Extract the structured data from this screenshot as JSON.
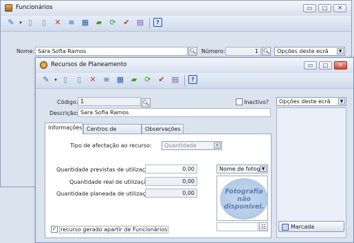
{
  "back_window": {
    "title": "Funcionários",
    "name_label": "Nome:",
    "name_value": "Sara Sofia Ramos",
    "number_label": "Número:",
    "number_value": "1",
    "options_value": "Opções deste ecrã"
  },
  "front_window": {
    "title": "Recursos de Planeamento",
    "codigo_label": "Código:",
    "codigo_value": "1",
    "inactivo_label": "Inactivo?",
    "descricao_label": "Descrição:",
    "descricao_value": "Sara Sofia Ramos",
    "options_value": "Opções deste ecrã",
    "tabs": [
      "Informações",
      "Centros de Trabalho",
      "Observações"
    ],
    "tipo_label": "Tipo de afectação ao recurso:",
    "tipo_value": "Quantidade",
    "qt_prevista_label": "Quantidade previstas de utilização:",
    "qt_prevista_value": "0,00",
    "qt_real_label": "Quantidade real de utilização:",
    "qt_real_value": "0,00",
    "qt_planeada_label": "Quantidade planeada de utilização:",
    "qt_planeada_value": "0,00",
    "photo_select_value": "Nome de fotogr",
    "photo_placeholder": "Fotografia não disponível.",
    "recurso_gerado_label": "recurso gerado apartir de Funcionários",
    "marcada_label": "Marcada"
  },
  "window_buttons": {
    "minimize": "▭",
    "restore": "□",
    "close": "✕"
  },
  "icons": [
    "tools-icon",
    "new-doc-icon",
    "copy-doc-icon",
    "delete-icon",
    "edit-icon",
    "grid-icon",
    "open-folder-icon",
    "refresh-icon",
    "check-icon",
    "print-icon",
    "help-icon"
  ]
}
